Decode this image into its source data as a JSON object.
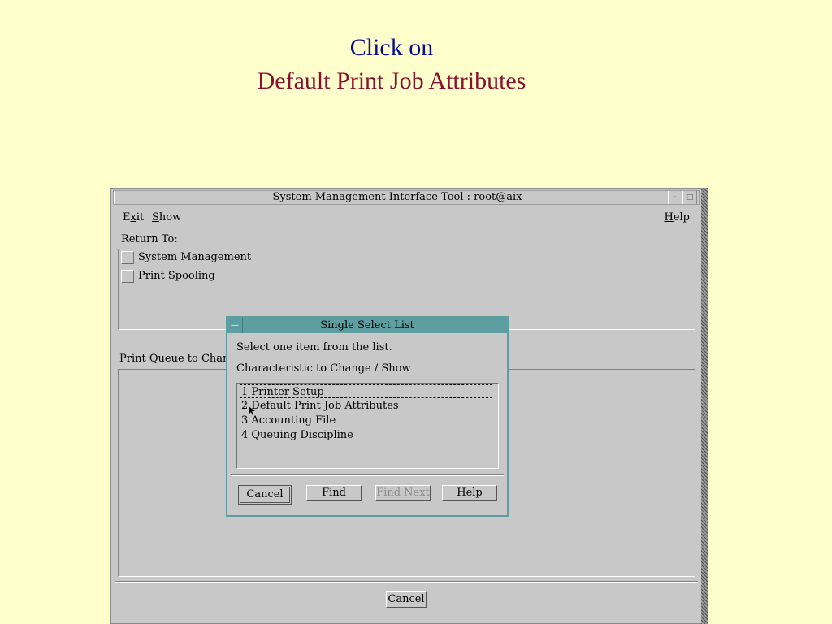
{
  "slide": {
    "title_line1": "Click on",
    "title_line2": "Default Print Job Attributes"
  },
  "window": {
    "title": "System Management Interface Tool : root@aix",
    "menu": {
      "exit": "Exit",
      "show": "Show",
      "help": "Help"
    },
    "return_to_label": "Return To:",
    "return_items": [
      "System Management",
      "Print Spooling"
    ],
    "print_queue_label": "Print Queue to Change / Show",
    "cancel_label": "Cancel"
  },
  "dialog": {
    "title": "Single Select List",
    "instruction": "Select one item from the list.",
    "list_label": "Characteristic to Change / Show",
    "items": [
      "1 Printer Setup",
      "2 Default Print Job Attributes",
      "3 Accounting File",
      "4 Queuing Discipline"
    ],
    "selected_index": 0,
    "buttons": {
      "cancel": "Cancel",
      "find": "Find",
      "find_next": "Find Next",
      "help": "Help"
    },
    "border_color": "#5f9ea0"
  },
  "icons": [
    "window-menu-icon",
    "minimize-icon",
    "maximize-icon",
    "mouse-cursor-icon"
  ]
}
